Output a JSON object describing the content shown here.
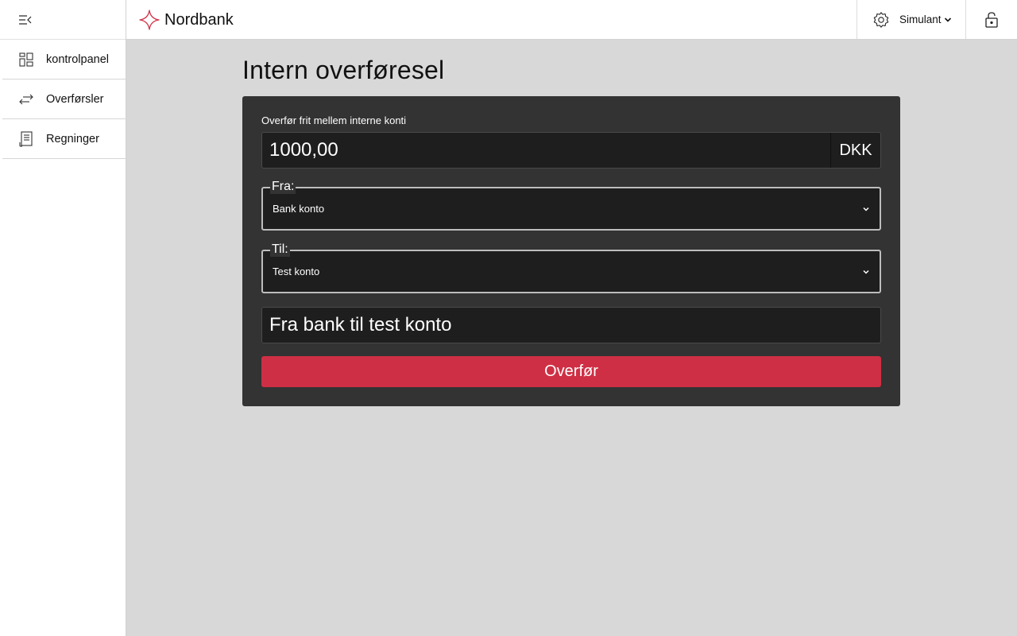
{
  "brand": {
    "name": "Nordbank",
    "accent_color": "#d0354a",
    "logo_icon": "sparkle-star-icon"
  },
  "sidebar": {
    "toggle_icon": "collapse-menu-icon",
    "items": [
      {
        "label": "kontrolpanel",
        "icon": "dashboard-grid-icon"
      },
      {
        "label": "Overførsler",
        "icon": "transfer-arrows-icon"
      },
      {
        "label": "Regninger",
        "icon": "receipt-icon"
      }
    ]
  },
  "header": {
    "user": {
      "name": "Simulant",
      "icon": "gear-icon"
    },
    "lock_icon": "lock-icon"
  },
  "main": {
    "title": "Intern overføresel",
    "form": {
      "description": "Overfør frit mellem interne konti",
      "amount": "1000,00",
      "currency": "DKK",
      "from_label": "Fra:",
      "from_value": "Bank konto",
      "to_label": "Til:",
      "to_value": "Test konto",
      "note": "Fra bank til test konto",
      "submit_label": "Overfør",
      "submit_color": "#cf2f44"
    }
  }
}
